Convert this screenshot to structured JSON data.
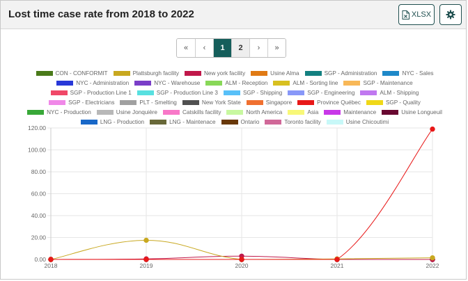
{
  "header": {
    "title": "Lost time case rate from 2018 to 2022",
    "xlsx_label": "XLSX",
    "xlsx_icon": "spreadsheet-file-icon",
    "settings_icon": "gear-icon",
    "accent": "#1f4f4f"
  },
  "pagination": {
    "first": "«",
    "prev": "‹",
    "pages": [
      "1",
      "2"
    ],
    "active_page": "1",
    "next": "›",
    "last": "»"
  },
  "chart_data": {
    "type": "line",
    "title": "",
    "xlabel": "",
    "ylabel": "",
    "x": [
      "2018",
      "2019",
      "2020",
      "2021",
      "2022"
    ],
    "ylim": [
      0,
      120
    ],
    "yticks": [
      "0.00",
      "20.00",
      "40.00",
      "60.00",
      "80.00",
      "100.00",
      "120.00"
    ],
    "grid": true,
    "legend_position": "top",
    "series": [
      {
        "name": "CON - CONFORMIT",
        "color": "#4a7a1a",
        "values": [
          0,
          0,
          0,
          0,
          0
        ]
      },
      {
        "name": "Plattsburgh facility",
        "color": "#c8a820",
        "values": [
          0,
          17.5,
          0,
          0.5,
          1.5
        ]
      },
      {
        "name": "New york facility",
        "color": "#c0184a",
        "values": [
          0,
          0.5,
          3,
          0,
          0
        ]
      },
      {
        "name": "Usine Alma",
        "color": "#e07a14",
        "values": [
          0,
          0,
          0,
          0,
          0
        ]
      },
      {
        "name": "SGP - Administration",
        "color": "#138080",
        "values": [
          0,
          0,
          0,
          0,
          0
        ]
      },
      {
        "name": "NYC - Sales",
        "color": "#1e88c8",
        "values": [
          0,
          0,
          0,
          0,
          0
        ]
      },
      {
        "name": "NYC - Administration",
        "color": "#2838d8",
        "values": [
          0,
          0,
          0,
          0,
          0
        ]
      },
      {
        "name": "NYC - Warehouse",
        "color": "#7a3ec8",
        "values": [
          0,
          0,
          0,
          0,
          0
        ]
      },
      {
        "name": "ALM - Reception",
        "color": "#88d858",
        "values": [
          0,
          0,
          0,
          0,
          0
        ]
      },
      {
        "name": "ALM - Sorting line",
        "color": "#d8c020",
        "values": [
          0,
          0,
          0,
          0,
          0
        ]
      },
      {
        "name": "SGP - Maintenance",
        "color": "#f8b858",
        "values": [
          0,
          0,
          0,
          0,
          0
        ]
      },
      {
        "name": "SGP - Production Line 1",
        "color": "#f04868",
        "values": [
          0,
          0,
          0,
          0,
          0
        ]
      },
      {
        "name": "SGP - Production Line 3",
        "color": "#58e0e0",
        "values": [
          0,
          0,
          0,
          0,
          0
        ]
      },
      {
        "name": "SGP - Shipping",
        "color": "#58c0f8",
        "values": [
          0,
          0,
          0,
          0,
          0
        ]
      },
      {
        "name": "SGP - Engineering",
        "color": "#8898f8",
        "values": [
          0,
          0,
          0,
          0,
          0
        ]
      },
      {
        "name": "ALM - Shipping",
        "color": "#c078f0",
        "values": [
          0,
          0,
          0,
          0,
          0
        ]
      },
      {
        "name": "SGP - Electricians",
        "color": "#f088e8",
        "values": [
          0,
          0,
          0,
          0,
          0
        ]
      },
      {
        "name": "PLT - Smelting",
        "color": "#a0a0a0",
        "values": [
          0,
          0,
          0,
          0,
          0
        ]
      },
      {
        "name": "New York State",
        "color": "#505050",
        "values": [
          0,
          0,
          0,
          0,
          0
        ]
      },
      {
        "name": "Singapore",
        "color": "#f07030",
        "values": [
          0,
          0,
          0,
          0,
          0
        ]
      },
      {
        "name": "Province Québec",
        "color": "#e81818",
        "values": [
          0,
          0,
          0,
          0,
          119
        ]
      },
      {
        "name": "SGP - Quality",
        "color": "#f0d818",
        "values": [
          0,
          0,
          0,
          0,
          0
        ]
      },
      {
        "name": "NYC - Production",
        "color": "#38a838",
        "values": [
          0,
          0,
          0,
          0,
          0
        ]
      },
      {
        "name": "Usine Jonquière",
        "color": "#b8b8b8",
        "values": [
          0,
          0,
          0,
          0,
          0
        ]
      },
      {
        "name": "Catskills facility",
        "color": "#f878c8",
        "values": [
          0,
          0,
          0,
          0,
          0
        ]
      },
      {
        "name": "North America",
        "color": "#c8f8a0",
        "values": [
          0,
          0,
          0,
          0,
          0
        ]
      },
      {
        "name": "Asia",
        "color": "#f8f878",
        "values": [
          0,
          0,
          0,
          0,
          0
        ]
      },
      {
        "name": "Maintenance",
        "color": "#c838e8",
        "values": [
          0,
          0,
          0,
          0,
          0
        ]
      },
      {
        "name": "Usine Longueuil",
        "color": "#680830",
        "values": [
          0,
          0,
          0,
          0,
          0
        ]
      },
      {
        "name": "LNG - Production",
        "color": "#1868c8",
        "values": [
          0,
          0,
          0,
          0,
          0
        ]
      },
      {
        "name": "LNG - Maintenace",
        "color": "#686838",
        "values": [
          0,
          0,
          0,
          0,
          0
        ]
      },
      {
        "name": "Ontario",
        "color": "#683808",
        "values": [
          0,
          0,
          0,
          0,
          0
        ]
      },
      {
        "name": "Toronto facility",
        "color": "#d06898",
        "values": [
          0,
          0,
          0,
          0,
          0
        ]
      },
      {
        "name": "Usine Chicoutimi",
        "color": "#c8f8f8",
        "values": [
          0,
          0,
          0,
          0,
          0
        ]
      }
    ]
  }
}
